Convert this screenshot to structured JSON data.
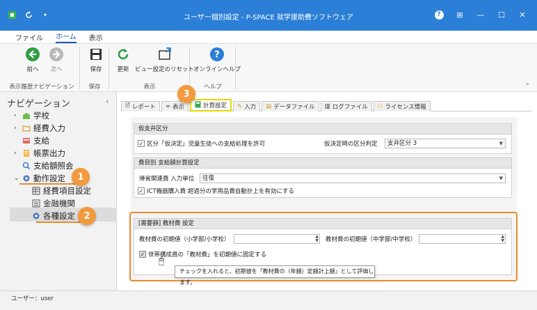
{
  "window": {
    "title": "ユーザー個別設定 - P-SPACE 就学援助費ソフトウェア",
    "controls": [
      "?",
      "⊞",
      "—",
      "☐",
      "✕"
    ]
  },
  "menu": {
    "items": [
      "ファイル",
      "ホーム",
      "表示"
    ],
    "active": "ホーム"
  },
  "ribbon": {
    "buttons": {
      "back": "前へ",
      "forward": "次へ",
      "save": "保存",
      "refresh": "更新",
      "reset_view": "ビュー設定のリセット",
      "online_help": "オンラインヘルプ"
    },
    "groups": {
      "history_nav": "表示履歴ナビゲーション",
      "save": "保存",
      "view": "表示",
      "help": "ヘルプ"
    }
  },
  "sidebar": {
    "title": "ナビゲーション",
    "collapse": "‹",
    "items": [
      {
        "label": "学校"
      },
      {
        "label": "経費入力"
      },
      {
        "label": "支給"
      },
      {
        "label": "帳票出力"
      },
      {
        "label": "支給額照会"
      },
      {
        "label": "動作設定"
      },
      {
        "label": "経費項目設定"
      },
      {
        "label": "金融機関"
      },
      {
        "label": "各種設定"
      }
    ]
  },
  "tabs": [
    {
      "label": "レポート"
    },
    {
      "label": "表示"
    },
    {
      "label": "計算設定",
      "active": true
    },
    {
      "label": "入力"
    },
    {
      "label": "データファイル"
    },
    {
      "label": "ログファイル"
    },
    {
      "label": "ライセンス情報"
    }
  ],
  "sections": {
    "provisional": {
      "header": "仮支弁区分",
      "checkbox_label": "区分「仮決定」児童生徒への支給処理を許可",
      "checkbox_checked": "✓",
      "judge_label": "仮決定時の区分判定",
      "judge_value": "支弁区分 3"
    },
    "per_item": {
      "header": "費目別 支給額計算設定",
      "unit_label": "帰省関連費 入力単位",
      "unit_value": "往復",
      "ict_label": "ICT機器購入費 超過分の学用品費自動計上を有効にする",
      "ict_checked": "✓"
    },
    "textbook": {
      "header": "[需要額] 教材費 設定",
      "elem_label": "教材費の初期値（小学部/小学校）",
      "elem_value": "",
      "junior_label": "教材費の初期値（中学部/中学校）",
      "junior_value": "",
      "fixed_label": "世帯構成員の「教材費」を初期値に固定する",
      "fixed_checked": "✓"
    }
  },
  "tooltip": "チェックを入れると、初期値を「教材費の（年額）定額計上額」として評価します。",
  "badges": {
    "one": "1",
    "two": "2",
    "three": "3"
  },
  "status": {
    "text": "ユーザー：user"
  },
  "colors": {
    "titlebar": "#2b7fd6",
    "accent": "#f19a3e",
    "tab_highlight": "#e6d800"
  }
}
